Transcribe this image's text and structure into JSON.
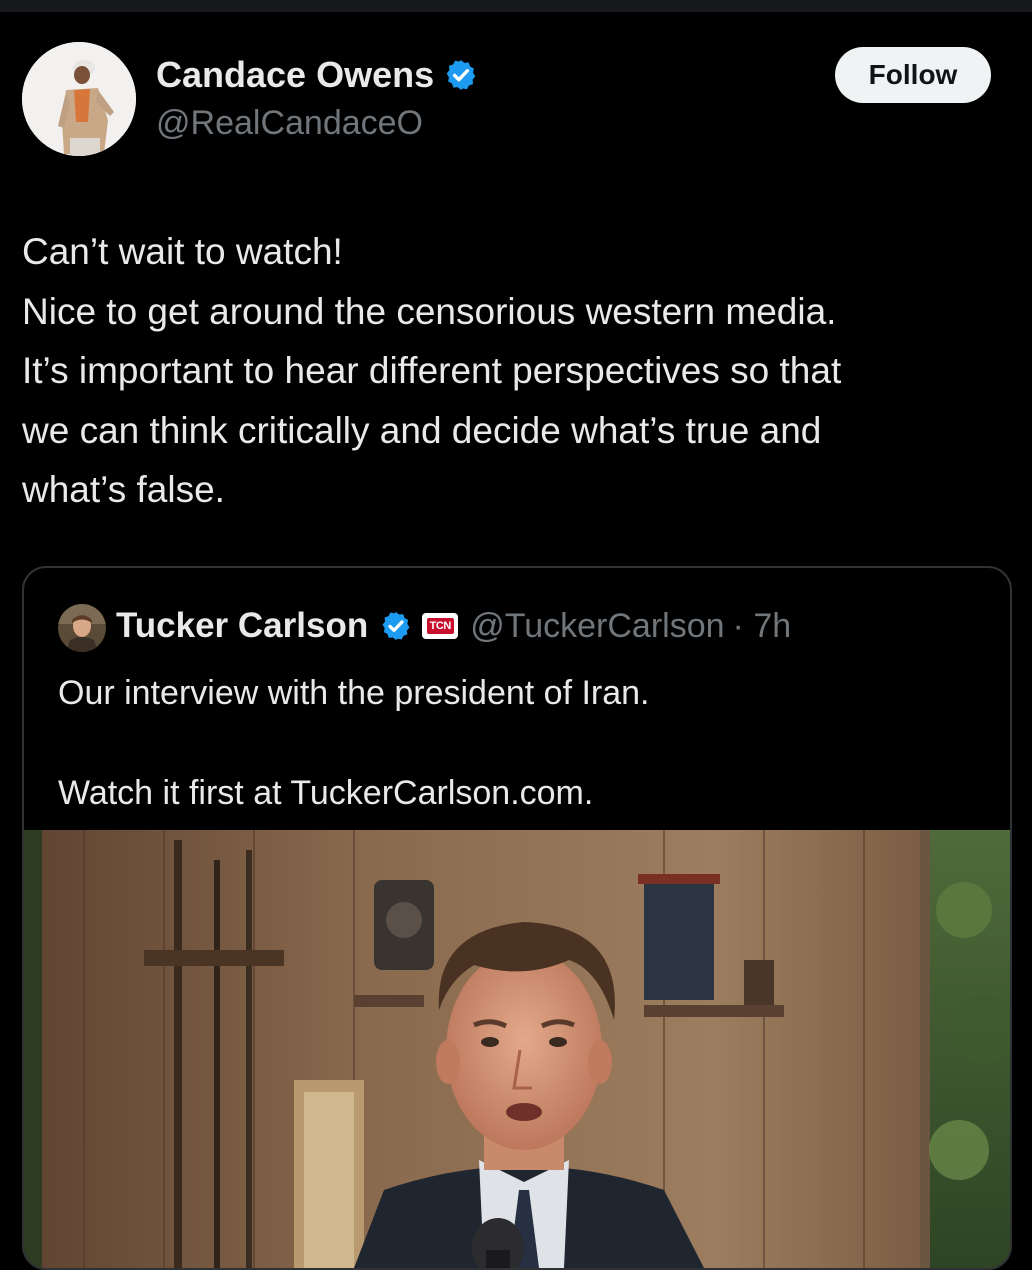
{
  "tweet": {
    "author": {
      "name": "Candace Owens",
      "handle": "@RealCandaceO",
      "verified": true
    },
    "follow_label": "Follow",
    "text_lines": [
      "Can’t wait to watch!",
      "Nice to get around the censorious western media.",
      "It’s important to hear different perspectives so that",
      "we can think critically and decide what’s true and",
      "what’s false."
    ]
  },
  "quoted": {
    "author": {
      "name": "Tucker Carlson",
      "handle": "@TuckerCarlson",
      "badge": "TCN",
      "verified": true
    },
    "time": "· 7h",
    "text_line_1": "Our interview with the president of Iran.",
    "text_line_2": "Watch it first at TuckerCarlson.com."
  },
  "colors": {
    "background": "#000000",
    "text": "#e7e9ea",
    "secondary": "#71767b",
    "verified_blue": "#1d9bf0",
    "border": "#2f3336"
  }
}
